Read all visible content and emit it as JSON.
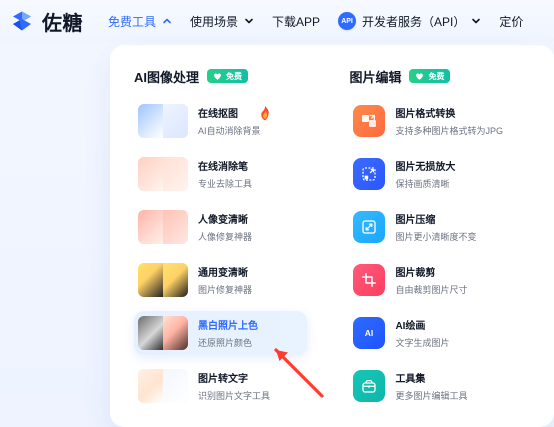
{
  "app": {
    "brand_name": "佐糖"
  },
  "nav": {
    "items": [
      {
        "label": "免费工具",
        "active": true,
        "has_chevron": true,
        "chevron": "chevron-up-icon"
      },
      {
        "label": "使用场景",
        "active": false,
        "has_chevron": true,
        "chevron": "chevron-down-icon"
      },
      {
        "label": "下载APP",
        "active": false,
        "has_chevron": false
      },
      {
        "label": "开发者服务（API）",
        "active": false,
        "has_chevron": true,
        "chevron": "chevron-down-icon",
        "badge": "API"
      },
      {
        "label": "定价",
        "active": false,
        "has_chevron": false
      }
    ]
  },
  "panel": {
    "left": {
      "title": "AI图像处理",
      "badge": "免费",
      "tools": [
        {
          "title": "在线抠图",
          "desc": "AI自动消除背景",
          "selected": false,
          "hot": true
        },
        {
          "title": "在线消除笔",
          "desc": "专业去除工具",
          "selected": false
        },
        {
          "title": "人像变清晰",
          "desc": "人像修复神器",
          "selected": false
        },
        {
          "title": "通用变清晰",
          "desc": "图片修复神器",
          "selected": false
        },
        {
          "title": "黑白照片上色",
          "desc": "还原照片颜色",
          "selected": true
        },
        {
          "title": "图片转文字",
          "desc": "识别图片文字工具",
          "selected": false
        }
      ]
    },
    "right": {
      "title": "图片编辑",
      "badge": "免费",
      "tools": [
        {
          "title": "图片格式转换",
          "desc": "支持多种图片格式转为JPG",
          "icon": "image-convert-icon",
          "color": "#ff8a4c"
        },
        {
          "title": "图片无损放大",
          "desc": "保持画质清晰",
          "icon": "image-upscale-icon",
          "color": "#3b6cff"
        },
        {
          "title": "图片压缩",
          "desc": "图片更小清晰度不变",
          "icon": "image-compress-icon",
          "color": "#36b9ff"
        },
        {
          "title": "图片裁剪",
          "desc": "自由裁剪图片尺寸",
          "icon": "crop-icon",
          "color": "#ff5a7b"
        },
        {
          "title": "AI绘画",
          "desc": "文字生成图片",
          "icon": "ai-paint-icon",
          "color": "#2f6bff"
        },
        {
          "title": "工具集",
          "desc": "更多图片编辑工具",
          "icon": "toolbox-icon",
          "color": "#16c6b7"
        }
      ]
    }
  },
  "colors": {
    "accent": "#2f6bff",
    "muted": "#6b7280",
    "text": "#1f2937",
    "badge_green": "#17c37b",
    "arrow_red": "#ff3b30"
  }
}
